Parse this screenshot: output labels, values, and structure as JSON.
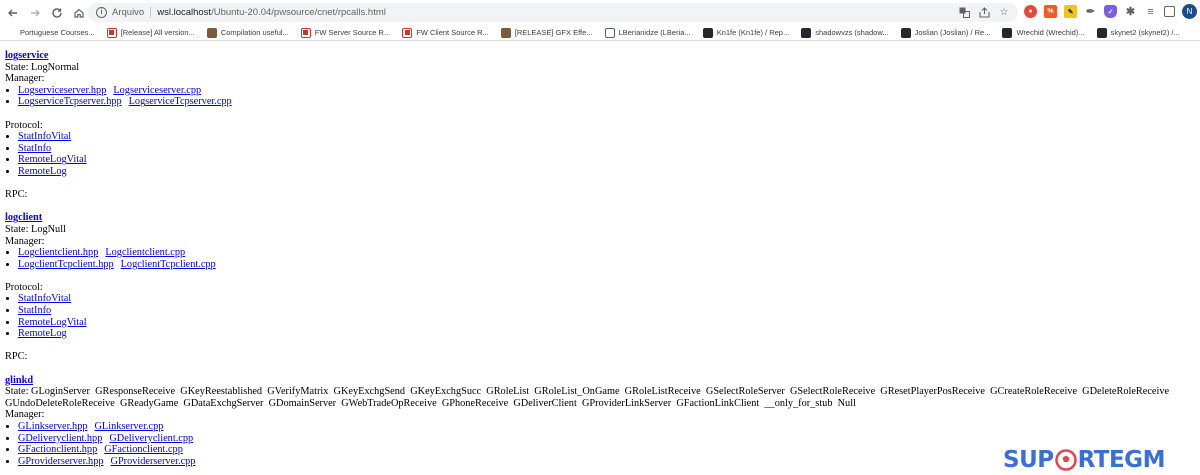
{
  "browser": {
    "protocol_label": "Arquivo",
    "url_host": "wsl.localhost",
    "url_path": "/Ubuntu-20.04/pwsource/cnet/rpcalls.html",
    "profile_initial": "N",
    "bookmarks": [
      {
        "label": "Portuguese Courses...",
        "icon": "cw-icon"
      },
      {
        "label": "[Release] All version...",
        "icon": "doc-icon"
      },
      {
        "label": "Compilation useful...",
        "icon": "image-icon"
      },
      {
        "label": "FW Server Source R...",
        "icon": "doc-icon"
      },
      {
        "label": "FW Client Source R...",
        "icon": "doc-icon"
      },
      {
        "label": "[RELEASE] GFX Effe...",
        "icon": "image-icon"
      },
      {
        "label": "LBerianidze (LBeria...",
        "icon": "lb-icon"
      },
      {
        "label": "Kn1fe (Kn1fe) / Rep...",
        "icon": "github-icon"
      },
      {
        "label": "shadowvzs (shadow...",
        "icon": "github-icon"
      },
      {
        "label": "Joslian (Joslian) / Re...",
        "icon": "github-icon"
      },
      {
        "label": "Wrechid (Wrechid)...",
        "icon": "github-icon"
      },
      {
        "label": "skynet2 (skynet2) /...",
        "icon": "github-icon"
      }
    ]
  },
  "sections": [
    {
      "title": "logservice",
      "state": "State: LogNormal",
      "manager_label": "Manager:",
      "manager": [
        [
          "Logserviceserver.hpp",
          "Logserviceserver.cpp"
        ],
        [
          "LogserviceTcpserver.hpp",
          "LogserviceTcpserver.cpp"
        ]
      ],
      "protocol_label": "Protocol:",
      "protocol": [
        "StatInfoVital",
        "StatInfo",
        "RemoteLogVital",
        "RemoteLog"
      ],
      "rpc_label": "RPC:"
    },
    {
      "title": "logclient",
      "state": "State: LogNull",
      "manager_label": "Manager:",
      "manager": [
        [
          "Logclientclient.hpp",
          "Logclientclient.cpp"
        ],
        [
          "LogclientTcpclient.hpp",
          "LogclientTcpclient.cpp"
        ]
      ],
      "protocol_label": "Protocol:",
      "protocol": [
        "StatInfoVital",
        "StatInfo",
        "RemoteLogVital",
        "RemoteLog"
      ],
      "rpc_label": "RPC:"
    },
    {
      "title": "glinkd",
      "state": "State: GLoginServer  GResponseReceive  GKeyReestablished  GVerifyMatrix  GKeyExchgSend  GKeyExchgSucc  GRoleList  GRoleList_OnGame  GRoleListReceive  GSelectRoleServer  GSelectRoleReceive  GResetPlayerPosReceive  GCreateRoleReceive  GDeleteRoleReceive",
      "state_cont": "GUndoDeleteRoleReceive  GReadyGame  GDataExchgServer  GDomainServer  GWebTradeOpReceive  GPhoneReceive  GDeliverClient  GProviderLinkServer  GFactionLinkClient  __only_for_stub  Null",
      "manager_label": "Manager:",
      "manager": [
        [
          "GLinkserver.hpp",
          "GLinkserver.cpp"
        ],
        [
          "GDeliveryclient.hpp",
          "GDeliveryclient.cpp"
        ],
        [
          "GFactionclient.hpp",
          "GFactionclient.cpp"
        ],
        [
          "GProviderserver.hpp",
          "GProviderserver.cpp"
        ]
      ]
    }
  ],
  "watermark": {
    "left": "SUP",
    "right": "RTEGM"
  }
}
